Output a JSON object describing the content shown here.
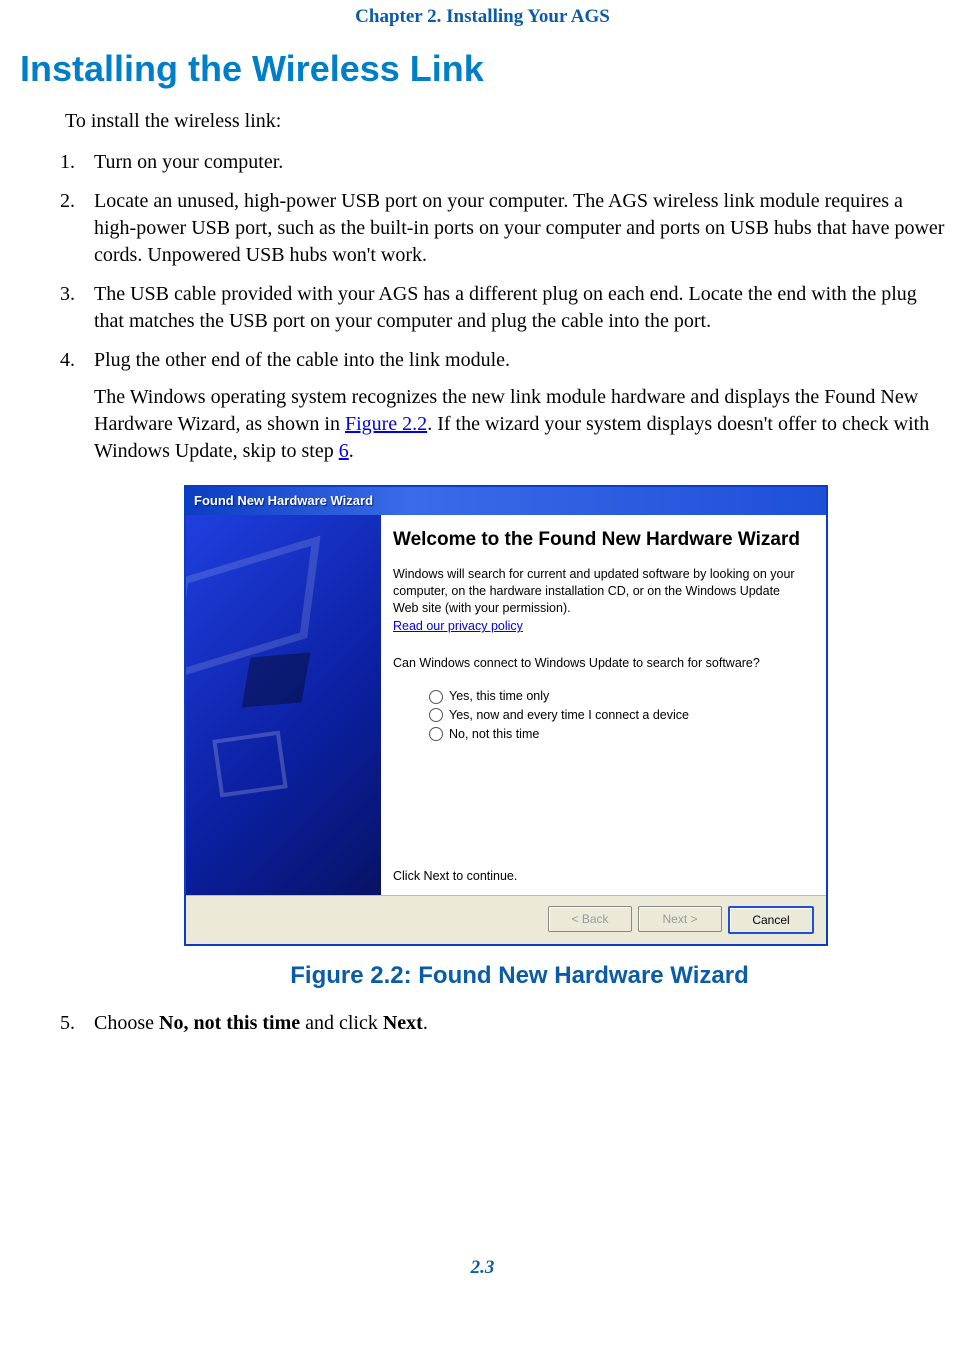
{
  "header": {
    "chapter": "Chapter 2. Installing Your AGS"
  },
  "title": "Installing the Wireless Link",
  "intro": "To install the wireless link:",
  "steps": {
    "s1": "Turn on your computer.",
    "s2": "Locate an unused, high-power USB port on your computer. The AGS wireless link module requires a high-power USB port, such as the built-in ports on your computer and ports on USB hubs that have power cords. Unpowered USB hubs won't work.",
    "s3": "The USB cable provided with your AGS has a different plug on each end. Locate the end with the plug that matches the USB port on your computer and plug the cable into the port.",
    "s4": "Plug the other end of the cable into the link module.",
    "s4_sub_a": "The Windows operating system recognizes the new link module hardware and displays the Found New Hardware Wizard, as shown in ",
    "s4_sub_link1": "Figure 2.2",
    "s4_sub_b": ". If the wizard your system displays doesn't offer to check with Windows Update, skip to step ",
    "s4_sub_link2": "6",
    "s4_sub_c": ".",
    "s5_a": "Choose ",
    "s5_b_bold": "No, not this time",
    "s5_c": " and click ",
    "s5_d_bold": "Next",
    "s5_e": "."
  },
  "wizard": {
    "title": "Found New Hardware Wizard",
    "heading": "Welcome to the Found New Hardware Wizard",
    "desc": "Windows will search for current and updated software by looking on your computer, on the hardware installation CD, or on the Windows Update Web site (with your permission).",
    "privacy_link": "Read our privacy policy",
    "question": "Can Windows connect to Windows Update to search for software?",
    "options": {
      "o1": "Yes, this time only",
      "o2": "Yes, now and every time I connect a device",
      "o3": "No, not this time"
    },
    "continue": "Click Next to continue.",
    "buttons": {
      "back": "< Back",
      "next": "Next >",
      "cancel": "Cancel"
    }
  },
  "figure_caption": "Figure 2.2: Found New Hardware Wizard",
  "page_number": "2.3"
}
